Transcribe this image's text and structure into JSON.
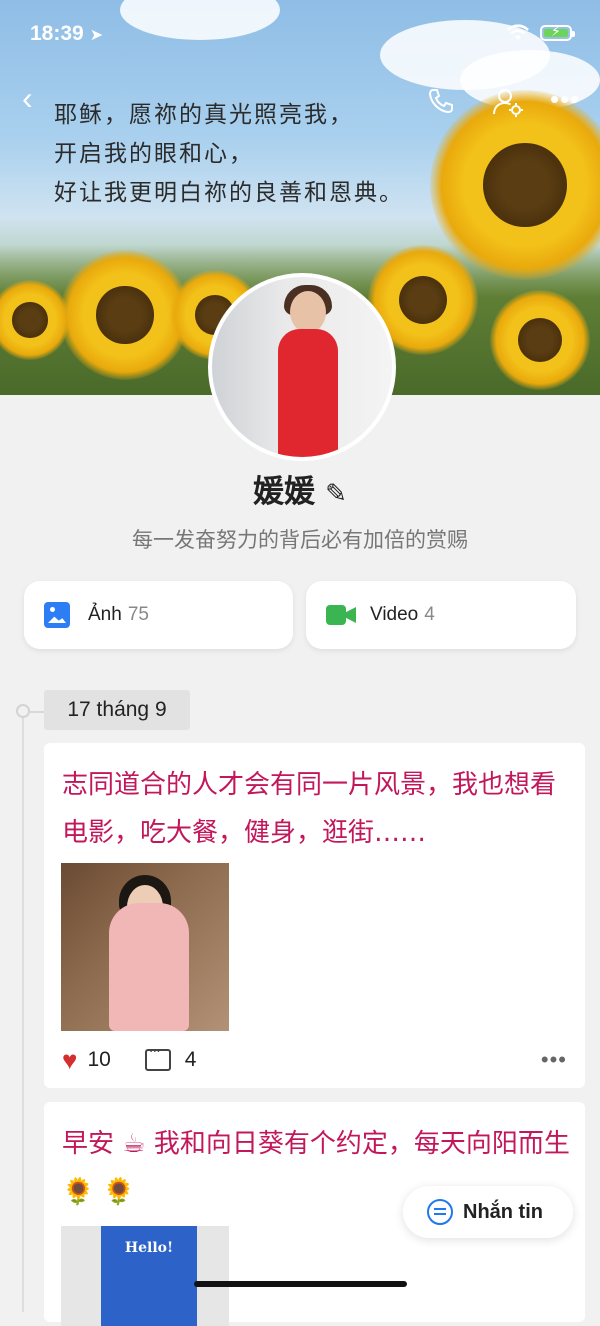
{
  "status_bar": {
    "time": "18:39"
  },
  "cover": {
    "poem_lines": [
      "耶稣，愿祢的真光照亮我，",
      "开启我的眼和心，",
      "好让我更明白祢的良善和恩典。"
    ]
  },
  "nav": {
    "back_icon": "chevron-left",
    "phone_icon": "phone",
    "settings_icon": "user-gear",
    "more_icon": "ellipsis"
  },
  "profile": {
    "name": "媛媛",
    "bio": "每一发奋努力的背后必有加倍的赏赐"
  },
  "media": {
    "photos": {
      "label": "Ảnh",
      "count": "75"
    },
    "videos": {
      "label": "Video",
      "count": "4"
    }
  },
  "timeline": {
    "date": "17 tháng 9",
    "posts": [
      {
        "text": "志同道合的人才会有同一片风景，我也想看电影，吃大餐，健身，逛街……",
        "likes": "10",
        "comments": "4"
      },
      {
        "text": "早安 ☕ 我和向日葵有个约定，每天向阳而生 🌻 🌻",
        "image_text": "Hello!"
      }
    ]
  },
  "message_button": {
    "label": "Nhắn tin"
  },
  "colors": {
    "post_text": "#c2185b",
    "accent": "#1e78f0",
    "photo_icon": "#2d7ef5",
    "video_icon": "#3bb452",
    "like": "#d32f2f"
  }
}
